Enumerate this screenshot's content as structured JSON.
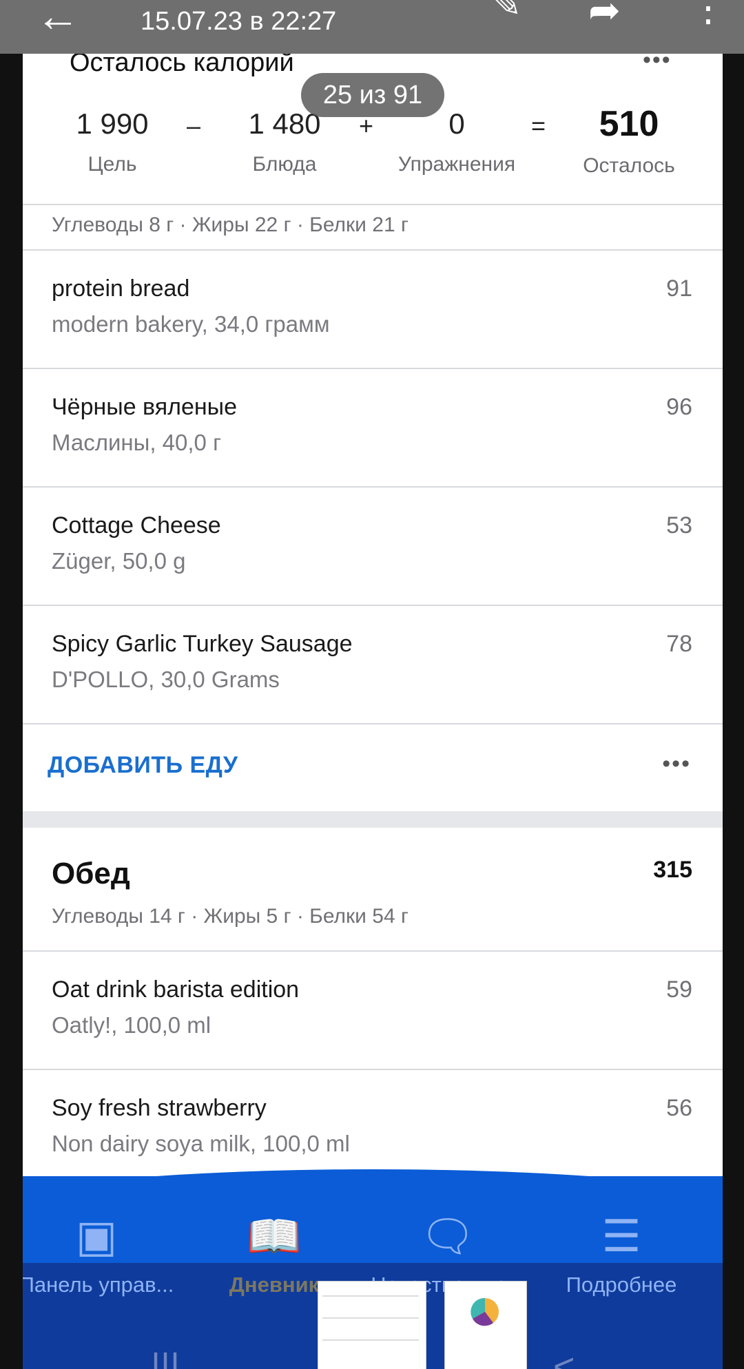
{
  "viewer": {
    "date": "15.07.23 в 22:27",
    "counter": "25 из 91"
  },
  "summary": {
    "title": "Осталось калорий",
    "goal_value": "1 990",
    "goal_label": "Цель",
    "minus": "–",
    "food_value": "1 480",
    "food_label": "Блюда",
    "plus": "+",
    "exercise_value": "0",
    "exercise_label": "Упражнения",
    "equals": "=",
    "remaining_value": "510",
    "remaining_label": "Осталось"
  },
  "breakfast": {
    "macros": "Углеводы 8 г · Жиры 22 г · Белки 21 г",
    "items": [
      {
        "name": "protein bread",
        "sub": "modern bakery, 34,0 грамм",
        "cal": "91"
      },
      {
        "name": "Чёрные вяленые",
        "sub": "Маслины, 40,0 г",
        "cal": "96"
      },
      {
        "name": "Cottage Cheese",
        "sub": "Züger, 50,0 g",
        "cal": "53"
      },
      {
        "name": "Spicy Garlic Turkey Sausage",
        "sub": "D'POLLO, 30,0 Grams",
        "cal": "78"
      }
    ],
    "add_label": "ДОБАВИТЬ ЕДУ"
  },
  "lunch": {
    "title": "Обед",
    "cal": "315",
    "macros": "Углеводы 14 г · Жиры 5 г · Белки 54 г",
    "items": [
      {
        "name": "Oat drink barista edition",
        "sub": "Oatly!, 100,0 ml",
        "cal": "59"
      },
      {
        "name": "Soy fresh strawberry",
        "sub": "Non dairy soya milk, 100,0 ml",
        "cal": "56"
      }
    ]
  },
  "nav": {
    "items": [
      {
        "label": "Панель управ...",
        "icon": "dashboard-icon"
      },
      {
        "label": "Дневник",
        "icon": "diary-icon"
      },
      {
        "label": "Новостная ле...",
        "icon": "newsfeed-icon"
      },
      {
        "label": "Подробнее",
        "icon": "menu-icon"
      }
    ]
  },
  "colors": {
    "accent": "#1a6fcf",
    "navbar": "#0b5cd6"
  }
}
